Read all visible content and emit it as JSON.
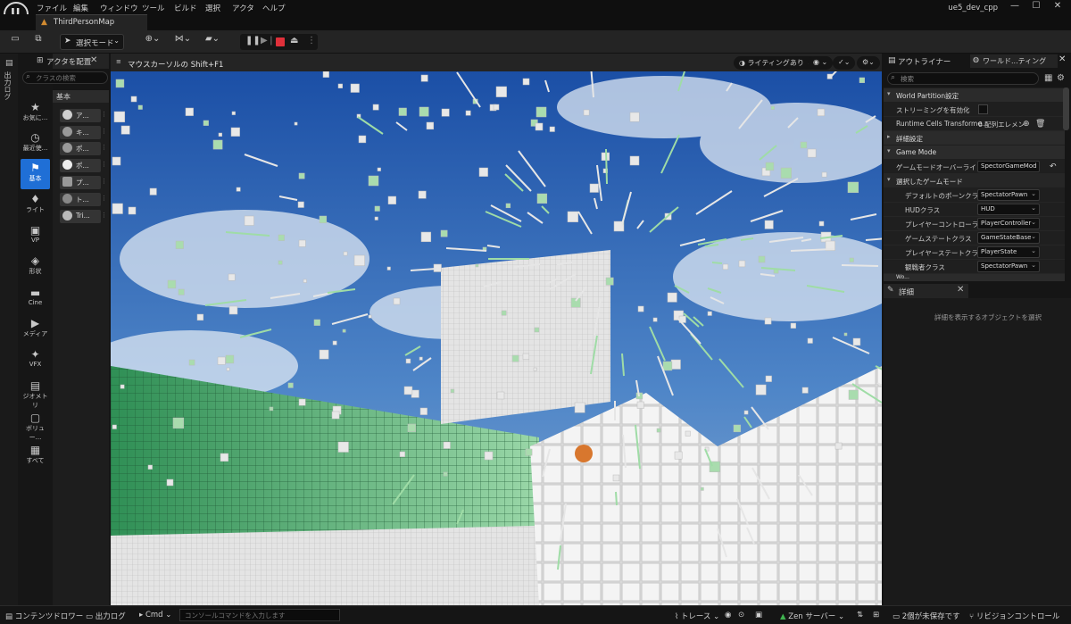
{
  "menubar": {
    "logo": "U",
    "items": [
      "ファイル",
      "編集",
      "ウィンドウ",
      "ツール",
      "ビルド",
      "選択",
      "アクタ",
      "ヘルプ"
    ],
    "project": "ue5_dev_cpp",
    "min": "—",
    "max": "☐",
    "close": "✕"
  },
  "tabs": {
    "map": "ThirdPersonMap"
  },
  "toolbar": {
    "save_icon": "save-icon",
    "mode_label": "選択モード",
    "play_icons": [
      "pause",
      "skip",
      "stop",
      "eject"
    ]
  },
  "left_panel": {
    "vertical_label": "出力ログ",
    "title": "アクタを配置",
    "close": "✕",
    "search_placeholder": "クラスの検索",
    "categories": [
      {
        "icon": "★",
        "label": "お気に..."
      },
      {
        "icon": "◷",
        "label": "最近使..."
      },
      {
        "icon": "⚑",
        "label": "基本",
        "selected": true
      },
      {
        "icon": "♦",
        "label": "ライト"
      },
      {
        "icon": "▣",
        "label": "VP"
      },
      {
        "icon": "◈",
        "label": "形状"
      },
      {
        "icon": "▬",
        "label": "Cine"
      },
      {
        "icon": "▶",
        "label": "メディア"
      },
      {
        "icon": "✦",
        "label": "VFX"
      },
      {
        "icon": "▤",
        "label": "ジオメトリ"
      },
      {
        "icon": "▢",
        "label": "ボリュー..."
      },
      {
        "icon": "▦",
        "label": "すべて"
      }
    ],
    "group": "基本",
    "actors": [
      "ア...",
      "キ...",
      "ポ...",
      "ポ...",
      "プ...",
      "ト...",
      "Tri..."
    ]
  },
  "viewport": {
    "menu_icon": "≡",
    "hint": "マウスカーソルの Shift+F1",
    "lighting": "ライティングあり"
  },
  "outliner": {
    "tab": "アウトライナー",
    "world_tab": "ワールド...ティング",
    "search_placeholder": "検索",
    "sections": {
      "wp": "World Partition設定",
      "detail": "詳細設定",
      "gamemode": "Game Mode",
      "selected_gm": "選択したゲームモード",
      "next": "Wo..."
    },
    "streaming": "ストリーミングを有効化",
    "runtime_cells": "Runtime Cells Transforme...",
    "runtime_value": "0 配列エレメン",
    "gm_override_label": "ゲームモードオーバーライド",
    "gm_override_value": "SpectorGameMod",
    "rows": [
      {
        "label": "デフォルトのポーンクラス",
        "value": "SpectatorPawn"
      },
      {
        "label": "HUDクラス",
        "value": "HUD"
      },
      {
        "label": "プレイヤーコントローラー:",
        "value": "PlayerController"
      },
      {
        "label": "ゲームステートクラス",
        "value": "GameStateBase"
      },
      {
        "label": "プレイヤーステートクラス",
        "value": "PlayerState"
      },
      {
        "label": "観戦者クラス",
        "value": "SpectatorPawn"
      }
    ]
  },
  "details": {
    "title": "詳細",
    "close": "✕",
    "empty": "詳細を表示するオブジェクトを選択"
  },
  "statusbar": {
    "content_drawer": "コンテンツドロワー",
    "output_log": "出力ログ",
    "cmd": "Cmd",
    "cmd_placeholder": "コンソールコマンドを入力します",
    "trace": "トレース",
    "zen": "Zen サーバー",
    "unsaved": "2個が未保存です",
    "revision": "リビジョンコントロール"
  }
}
